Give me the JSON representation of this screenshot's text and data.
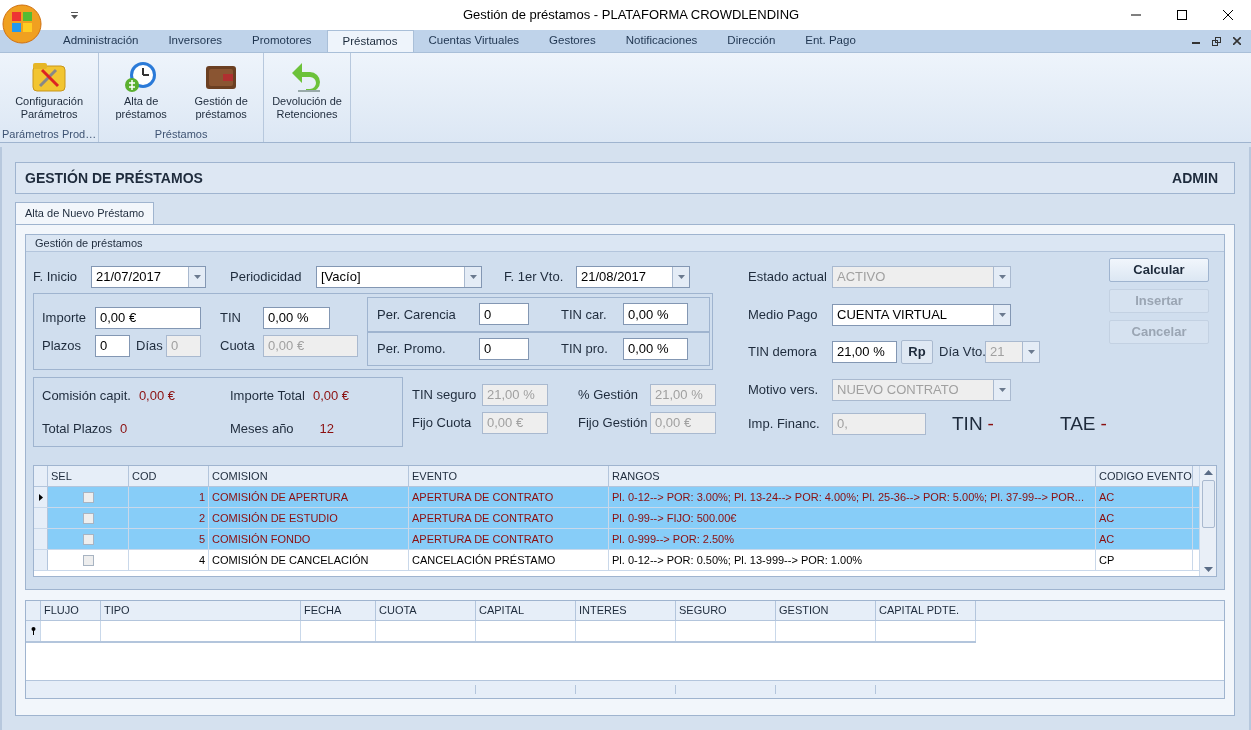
{
  "window": {
    "title": "Gestión de préstamos - PLATAFORMA CROWDLENDING"
  },
  "menu_tabs": [
    {
      "label": "Administración",
      "selected": false
    },
    {
      "label": "Inversores",
      "selected": false
    },
    {
      "label": "Promotores",
      "selected": false
    },
    {
      "label": "Préstamos",
      "selected": true
    },
    {
      "label": "Cuentas Virtuales",
      "selected": false
    },
    {
      "label": "Gestores",
      "selected": false
    },
    {
      "label": "Notificaciones",
      "selected": false
    },
    {
      "label": "Dirección",
      "selected": false
    },
    {
      "label": "Ent. Pago",
      "selected": false
    }
  ],
  "ribbon": [
    {
      "label": "Parámetros Prod…",
      "buttons": [
        {
          "kind": "config",
          "lines": [
            "Configuración",
            "Parámetros"
          ]
        }
      ]
    },
    {
      "label": "Préstamos",
      "buttons": [
        {
          "kind": "clock",
          "lines": [
            "Alta de",
            "préstamos"
          ]
        },
        {
          "kind": "wallet",
          "lines": [
            "Gestión de",
            "préstamos"
          ]
        }
      ]
    },
    {
      "buttons": [
        {
          "kind": "return",
          "lines": [
            "Devolución de",
            "Retenciones"
          ]
        }
      ]
    }
  ],
  "header": {
    "title": "GESTIÓN DE PRÉSTAMOS",
    "user": "ADMIN"
  },
  "inner_tabs": [
    {
      "label": "Alta de Nuevo Préstamo",
      "selected": true
    }
  ],
  "group_title": "Gestión de préstamos",
  "top_row": [
    {
      "label": "F. Inicio",
      "value": "21/07/2017"
    },
    {
      "label": "Periodicidad",
      "value": "[Vacío]"
    },
    {
      "label": "F. 1er Vto.",
      "value": "21/08/2017"
    }
  ],
  "loan": {
    "importe": {
      "label": "Importe",
      "value": "0,00 €",
      "disabled": false
    },
    "tin": {
      "label": "TIN",
      "value": "0,00 %",
      "disabled": false
    },
    "plazos": {
      "label": "Plazos",
      "value": "0",
      "disabled": false
    },
    "dias": {
      "label": "Días",
      "value": "0",
      "disabled": true
    },
    "cuota": {
      "label": "Cuota",
      "value": "0,00 €",
      "disabled": true
    }
  },
  "periods": [
    {
      "label": "Per. Carencia",
      "value": "0",
      "rate_label": "TIN car.",
      "rate": "0,00 %"
    },
    {
      "label": "Per. Promo.",
      "value": "0",
      "rate_label": "TIN pro.",
      "rate": "0,00 %"
    }
  ],
  "summary": [
    {
      "label": "Comisión capit.",
      "value": "0,00 €"
    },
    {
      "label": "Importe Total",
      "value": "0,00 €"
    },
    {
      "label": "Total Plazos",
      "value": "0"
    },
    {
      "label": "Meses año",
      "value": "12"
    }
  ],
  "fees": [
    {
      "label": "TIN seguro",
      "value": "21,00 %",
      "disabled": true
    },
    {
      "label": "% Gestión",
      "value": "21,00 %",
      "disabled": true
    },
    {
      "label": "Fijo Cuota",
      "value": "0,00 €",
      "disabled": true
    },
    {
      "label": "Fijo Gestión",
      "value": "0,00 €",
      "disabled": true
    }
  ],
  "status": {
    "estado": {
      "label": "Estado actual",
      "value": "ACTIVO",
      "disabled": true
    },
    "medio": {
      "label": "Medio Pago",
      "value": "CUENTA VIRTUAL",
      "disabled": false
    },
    "demora": {
      "label": "TIN demora",
      "value": "21,00 %",
      "button": "Rp"
    },
    "dia": {
      "label": "Día Vto.",
      "value": "21",
      "disabled": true
    },
    "motivo": {
      "label": "Motivo vers.",
      "value": "NUEVO CONTRATO",
      "disabled": true
    },
    "financ": {
      "label": "Imp. Financ.",
      "value": "0,",
      "disabled": true
    },
    "tin": {
      "label": "TIN",
      "value": "-"
    },
    "tae": {
      "label": "TAE",
      "value": "-"
    }
  },
  "actions": [
    {
      "label": "Calcular",
      "disabled": false
    },
    {
      "label": "Insertar",
      "disabled": true
    },
    {
      "label": "Cancelar",
      "disabled": true
    }
  ],
  "commissions": {
    "columns": [
      "SEL",
      "COD",
      "COMISION",
      "EVENTO",
      "RANGOS",
      "CODIGO EVENTO"
    ],
    "rows": [
      {
        "checked": false,
        "current": true,
        "selected": true,
        "cod": "1",
        "comision": "COMISIÓN DE APERTURA",
        "evento": "APERTURA DE CONTRATO",
        "rangos": "Pl. 0-12--> POR: 3.00%; Pl. 13-24--> POR: 4.00%; Pl. 25-36--> POR: 5.00%; Pl. 37-99--> POR...",
        "codigo": "AC"
      },
      {
        "checked": false,
        "current": false,
        "selected": true,
        "cod": "2",
        "comision": "COMISIÓN DE ESTUDIO",
        "evento": "APERTURA DE CONTRATO",
        "rangos": "Pl. 0-99--> FIJO: 500.00€",
        "codigo": "AC"
      },
      {
        "checked": false,
        "current": false,
        "selected": true,
        "cod": "5",
        "comision": "COMISIÓN FONDO",
        "evento": "APERTURA DE CONTRATO",
        "rangos": "Pl. 0-999--> POR: 2.50%",
        "codigo": "AC"
      },
      {
        "checked": false,
        "current": false,
        "selected": false,
        "cod": "4",
        "comision": "COMISIÓN DE CANCELACIÓN",
        "evento": "CANCELACIÓN PRÉSTAMO",
        "rangos": "Pl. 0-12--> POR: 0.50%; Pl. 13-999--> POR: 1.00%",
        "codigo": "CP"
      }
    ]
  },
  "schedule": {
    "columns": [
      "FLUJO",
      "TIPO",
      "FECHA",
      "CUOTA",
      "CAPITAL",
      "INTERES",
      "SEGURO",
      "GESTION",
      "CAPITAL PDTE."
    ]
  }
}
